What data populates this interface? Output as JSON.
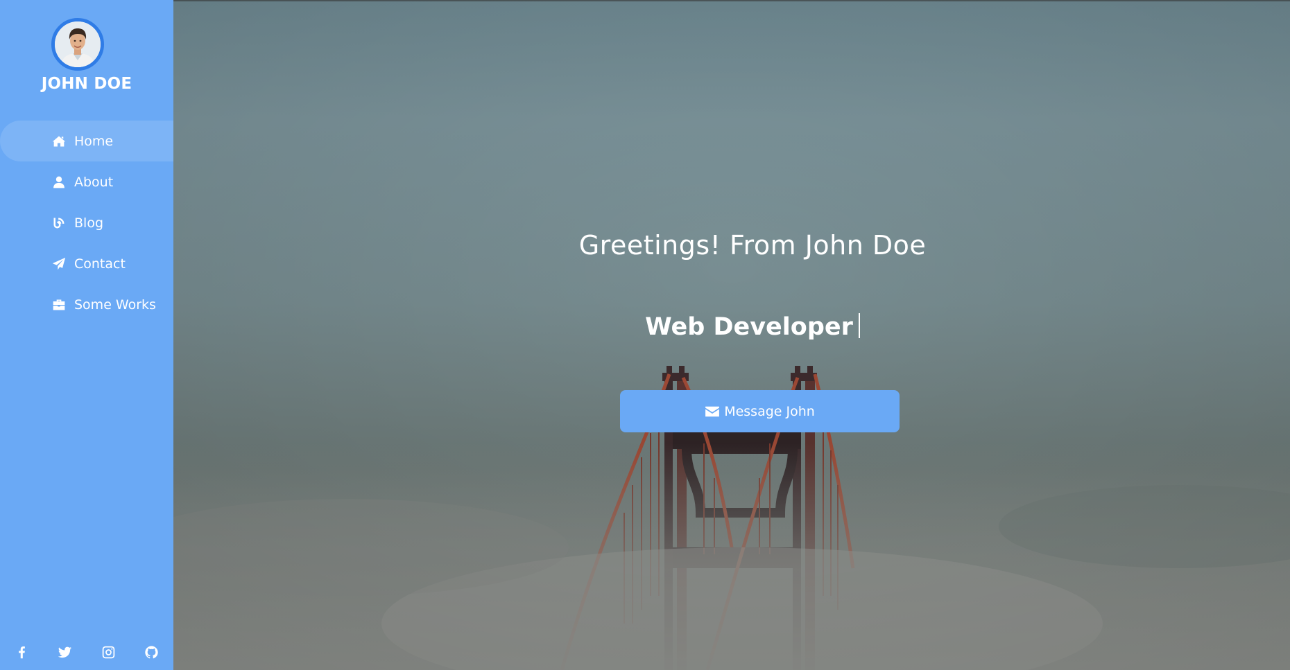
{
  "profile": {
    "name": "JOHN DOE",
    "avatar_alt": "avatar"
  },
  "nav": {
    "items": [
      {
        "label": "Home",
        "icon": "home-icon",
        "active": true
      },
      {
        "label": "About",
        "icon": "user-icon",
        "active": false
      },
      {
        "label": "Blog",
        "icon": "blog-icon",
        "active": false
      },
      {
        "label": "Contact",
        "icon": "paper-plane-icon",
        "active": false
      },
      {
        "label": "Some Works",
        "icon": "briefcase-icon",
        "active": false
      }
    ]
  },
  "social": {
    "items": [
      {
        "icon": "facebook-icon"
      },
      {
        "icon": "twitter-icon"
      },
      {
        "icon": "instagram-icon"
      },
      {
        "icon": "github-icon"
      }
    ]
  },
  "hero": {
    "greeting": "Greetings! From John Doe",
    "role": "Web Developer",
    "cta_label": "Message John",
    "cta_icon": "envelope-icon"
  },
  "colors": {
    "accent": "#6aa9f5",
    "avatar_ring": "#2f7ce6"
  }
}
